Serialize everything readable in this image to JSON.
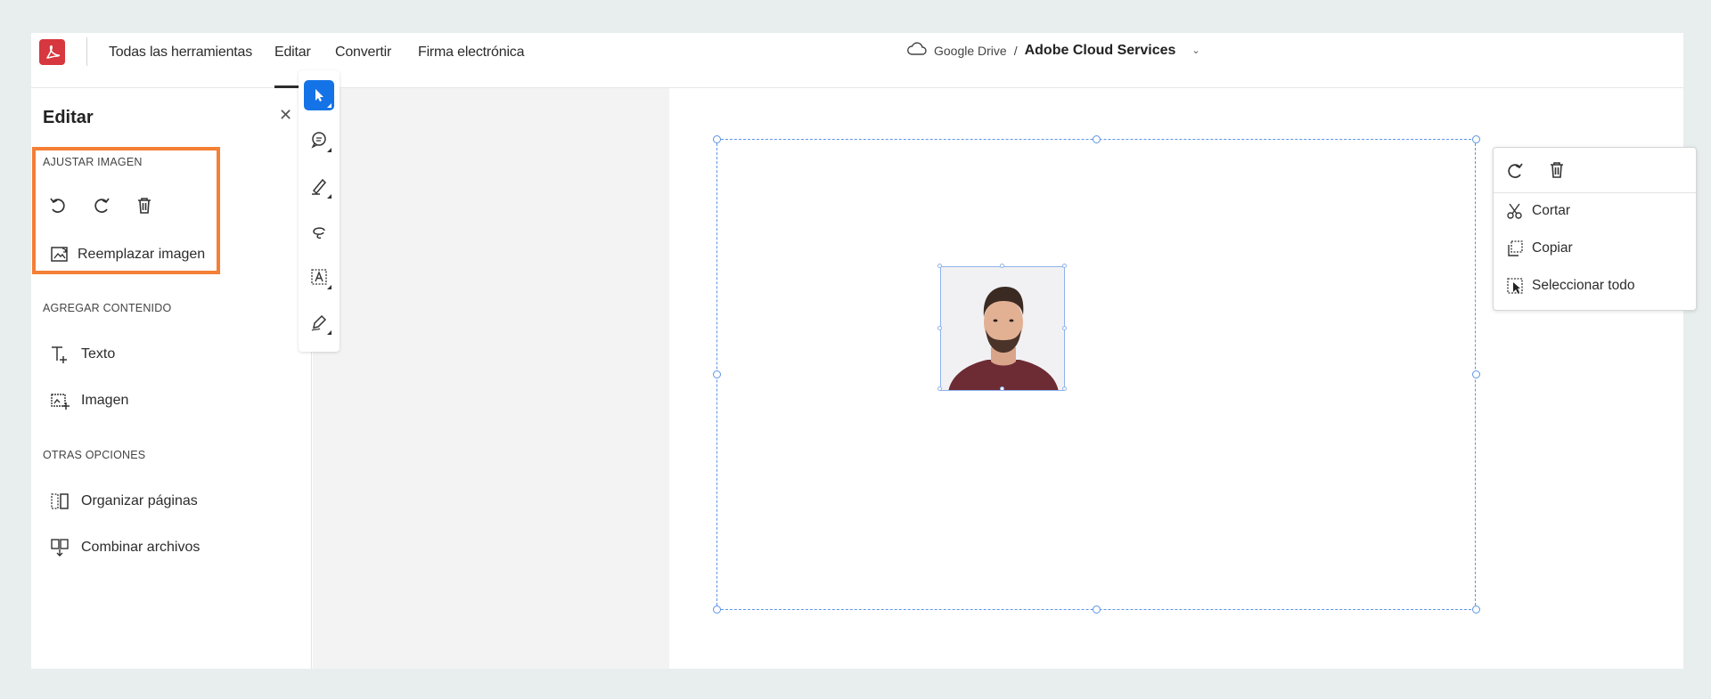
{
  "topbar": {
    "nav": [
      "Todas las herramientas",
      "Editar",
      "Convertir",
      "Firma electrónica"
    ],
    "active_tab": "Editar",
    "breadcrumb_source": "Google Drive",
    "breadcrumb_separator": "/",
    "breadcrumb_current": "Adobe Cloud Services"
  },
  "left_panel": {
    "title": "Editar",
    "adjust_image": {
      "heading": "AJUSTAR IMAGEN",
      "replace_label": "Reemplazar imagen"
    },
    "add_content": {
      "heading": "AGREGAR CONTENIDO",
      "items": [
        "Texto",
        "Imagen"
      ]
    },
    "other_options": {
      "heading": "OTRAS OPCIONES",
      "items": [
        "Organizar páginas",
        "Combinar archivos"
      ]
    }
  },
  "context_menu": {
    "items": [
      "Cortar",
      "Copiar",
      "Seleccionar todo"
    ]
  },
  "colors": {
    "accent": "#1473e6",
    "highlight": "#f47f35",
    "selection": "#5b95e8",
    "brand": "#d7373f"
  },
  "icons": {
    "vertical_toolbar": [
      "select-pointer-icon",
      "comment-icon",
      "pen-icon",
      "lasso-icon",
      "text-box-icon",
      "sign-icon"
    ]
  }
}
